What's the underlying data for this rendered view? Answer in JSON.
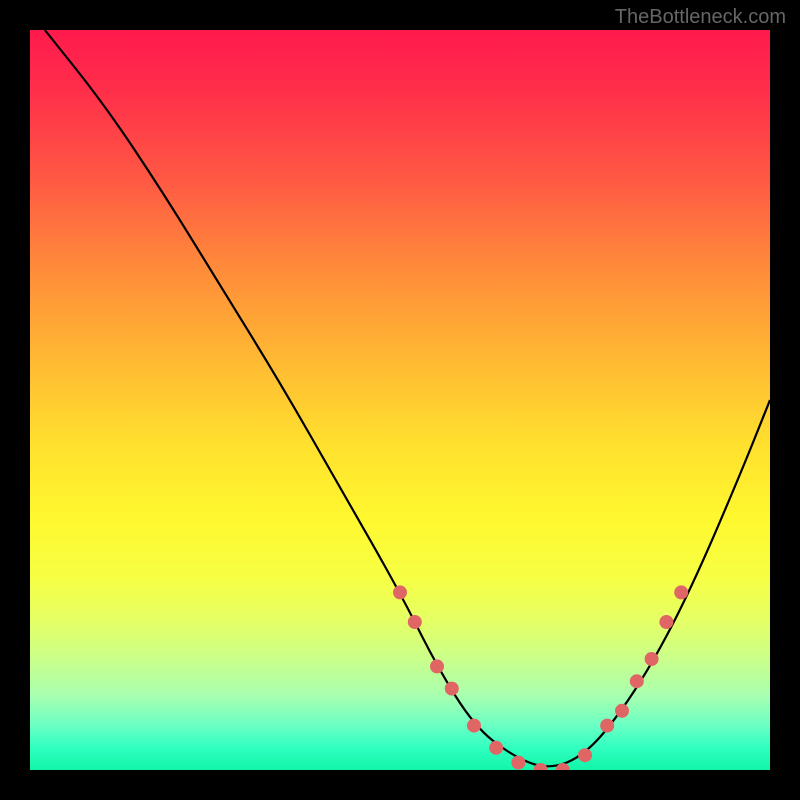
{
  "watermark": "TheBottleneck.com",
  "chart_data": {
    "type": "line",
    "title": "",
    "xlabel": "",
    "ylabel": "",
    "xlim": [
      0,
      100
    ],
    "ylim": [
      0,
      100
    ],
    "series": [
      {
        "name": "bottleneck-curve",
        "x": [
          2,
          10,
          18,
          26,
          34,
          42,
          50,
          55,
          60,
          65,
          70,
          75,
          80,
          85,
          90,
          96,
          100
        ],
        "values": [
          100,
          90,
          78,
          65,
          52,
          38,
          24,
          14,
          6,
          2,
          0,
          2,
          8,
          16,
          26,
          40,
          50
        ]
      }
    ],
    "points": {
      "name": "highlight-dots",
      "color": "#e06666",
      "x": [
        50,
        52,
        55,
        57,
        60,
        63,
        66,
        69,
        72,
        75,
        78,
        80,
        82,
        84,
        86,
        88
      ],
      "values": [
        24,
        20,
        14,
        11,
        6,
        3,
        1,
        0,
        0,
        2,
        6,
        8,
        12,
        15,
        20,
        24
      ]
    },
    "gradient_stops": [
      {
        "pos": 0,
        "color": "#ff1a4d"
      },
      {
        "pos": 20,
        "color": "#ff5844"
      },
      {
        "pos": 44,
        "color": "#ffb733"
      },
      {
        "pos": 66,
        "color": "#fff82f"
      },
      {
        "pos": 85,
        "color": "#caff8a"
      },
      {
        "pos": 100,
        "color": "#12f5a8"
      }
    ]
  }
}
